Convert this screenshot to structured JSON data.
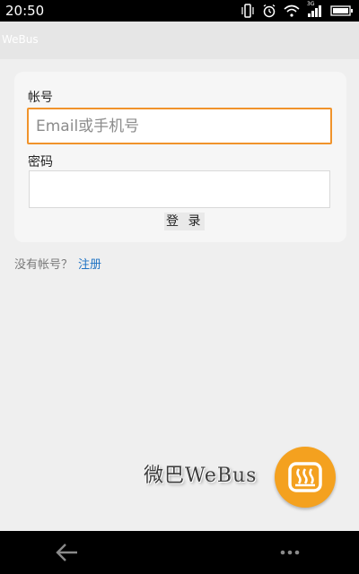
{
  "status_bar": {
    "time": "20:50",
    "icons": [
      "vibrate-icon",
      "alarm-icon",
      "wifi-icon",
      "signal-3g-icon",
      "battery-icon"
    ],
    "network_label": "3G"
  },
  "app_bar": {
    "title": "WeBus"
  },
  "login_form": {
    "account_label": "帐号",
    "account_placeholder": "Email或手机号",
    "account_value": "",
    "password_label": "密码",
    "password_value": "",
    "login_button_label": "登 录"
  },
  "signup": {
    "prompt": "没有帐号？",
    "link_label": "注册"
  },
  "brand": {
    "text": "微巴WeBus",
    "fab_icon": "webus-logo-icon"
  },
  "nav_bar": {
    "icons": [
      "back-arrow-icon",
      "more-dots-icon"
    ]
  },
  "colors": {
    "accent_orange": "#f4a11f",
    "input_focus_border": "#f0932b",
    "link_blue": "#1e73c4",
    "background": "#efefef"
  }
}
